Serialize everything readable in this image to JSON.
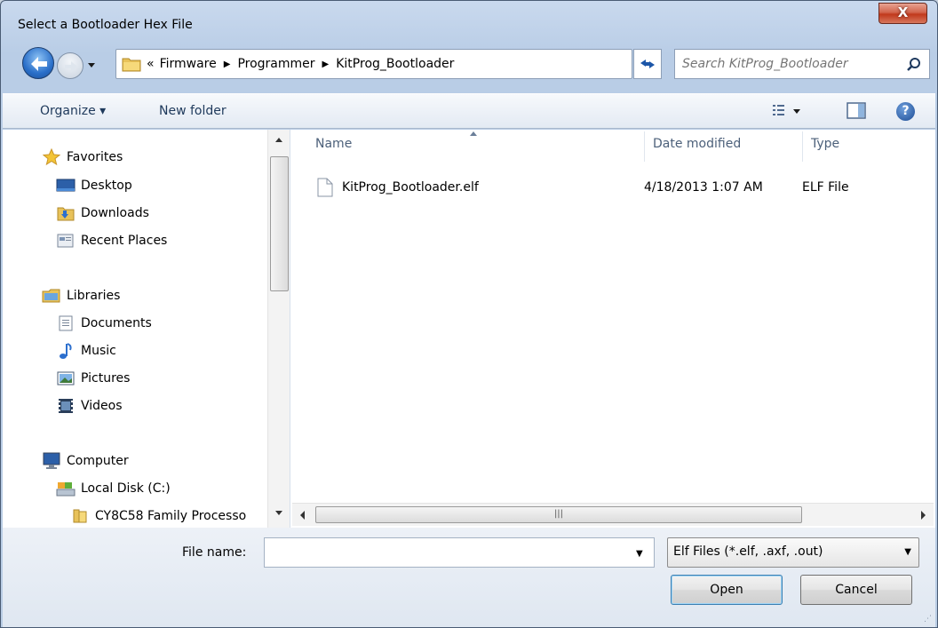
{
  "window": {
    "title": "Select a Bootloader Hex File",
    "close_label": "X"
  },
  "address": {
    "overflow": "«",
    "crumbs": [
      "Firmware",
      "Programmer",
      "KitProg_Bootloader"
    ]
  },
  "search": {
    "placeholder": "Search KitProg_Bootloader"
  },
  "toolbar": {
    "organize": "Organize ▾",
    "new_folder": "New folder",
    "help": "?"
  },
  "nav": {
    "favorites": "Favorites",
    "desktop": "Desktop",
    "downloads": "Downloads",
    "recent": "Recent Places",
    "libraries": "Libraries",
    "documents": "Documents",
    "music": "Music",
    "pictures": "Pictures",
    "videos": "Videos",
    "computer": "Computer",
    "local_disk": "Local Disk (C:)",
    "cy8c58": "CY8C58 Family Processo"
  },
  "columns": {
    "name": "Name",
    "date": "Date modified",
    "type": "Type"
  },
  "files": [
    {
      "name": "KitProg_Bootloader.elf",
      "date": "4/18/2013 1:07 AM",
      "type": "ELF File"
    }
  ],
  "bottom": {
    "file_name_label": "File name:",
    "file_name_value": "",
    "filter": "Elf Files (*.elf, .axf, .out)",
    "open": "Open",
    "cancel": "Cancel"
  },
  "colors": {
    "accent": "#1e395b",
    "window_frame": "#b9cde6",
    "close": "#c1391c"
  }
}
